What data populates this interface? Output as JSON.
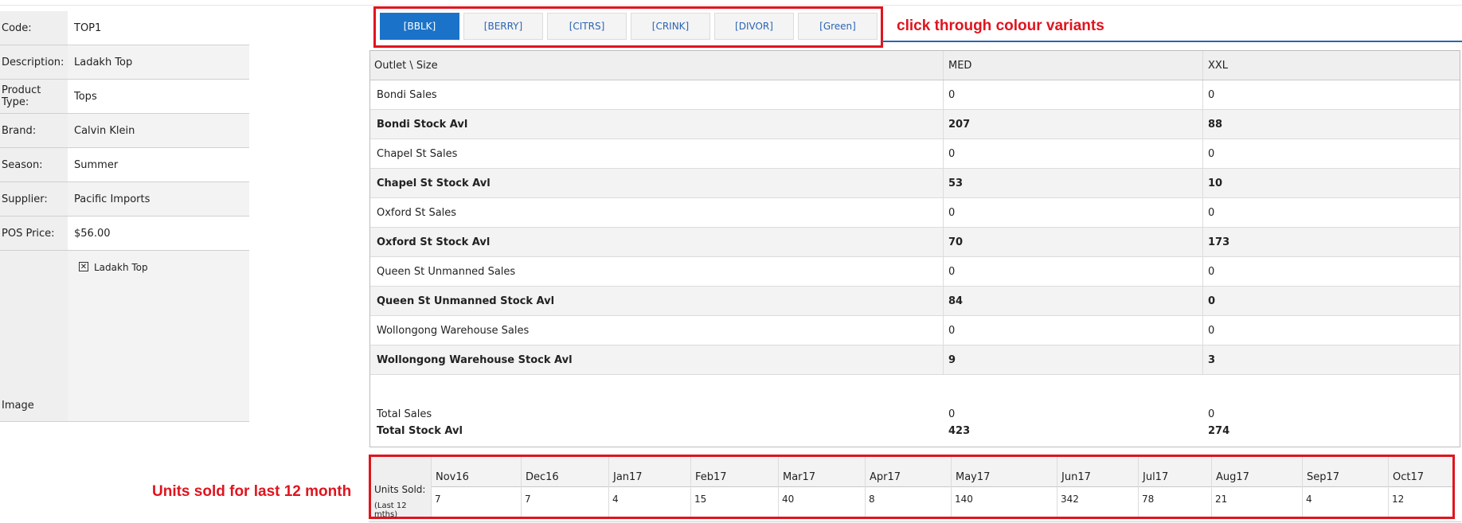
{
  "product": {
    "fields": [
      {
        "label": "Code:",
        "value": "TOP1"
      },
      {
        "label": "Description:",
        "value": "Ladakh Top"
      },
      {
        "label": "Product Type:",
        "value": "Tops"
      },
      {
        "label": "Brand:",
        "value": "Calvin Klein"
      },
      {
        "label": "Season:",
        "value": "Summer"
      },
      {
        "label": "Supplier:",
        "value": "Pacific Imports"
      },
      {
        "label": "POS Price:",
        "value": "$56.00"
      }
    ],
    "image_label": "Image",
    "image_alt": "Ladakh Top",
    "image_icon": "broken-image-icon"
  },
  "variants": {
    "tabs": [
      "[BBLK]",
      "[BERRY]",
      "[CITRS]",
      "[CRINK]",
      "[DIVOR]",
      "[Green]"
    ],
    "active_index": 0,
    "annotation": "click through colour variants"
  },
  "stock_table": {
    "headers": [
      "Outlet \\ Size",
      "MED",
      "XXL"
    ],
    "rows": [
      {
        "outlet": "Bondi Sales",
        "med": "0",
        "xxl": "0",
        "bold": false
      },
      {
        "outlet": "Bondi Stock Avl",
        "med": "207",
        "xxl": "88",
        "bold": true
      },
      {
        "outlet": "Chapel St Sales",
        "med": "0",
        "xxl": "0",
        "bold": false
      },
      {
        "outlet": "Chapel St Stock Avl",
        "med": "53",
        "xxl": "10",
        "bold": true
      },
      {
        "outlet": "Oxford St Sales",
        "med": "0",
        "xxl": "0",
        "bold": false
      },
      {
        "outlet": "Oxford St Stock Avl",
        "med": "70",
        "xxl": "173",
        "bold": true
      },
      {
        "outlet": "Queen St Unmanned Sales",
        "med": "0",
        "xxl": "0",
        "bold": false
      },
      {
        "outlet": "Queen St Unmanned Stock Avl",
        "med": "84",
        "xxl": "0",
        "bold": true
      },
      {
        "outlet": "Wollongong Warehouse Sales",
        "med": "0",
        "xxl": "0",
        "bold": false
      },
      {
        "outlet": "Wollongong Warehouse Stock Avl",
        "med": "9",
        "xxl": "3",
        "bold": true
      }
    ],
    "totals": [
      {
        "label": "Total Sales",
        "med": "0",
        "xxl": "0",
        "bold": false
      },
      {
        "label": "Total Stock Avl",
        "med": "423",
        "xxl": "274",
        "bold": true
      }
    ]
  },
  "units_sold": {
    "annotation": "Units sold for last 12 month",
    "label": "Units Sold:",
    "sublabel": "(Last 12 mths)",
    "months": [
      "Nov16",
      "Dec16",
      "Jan17",
      "Feb17",
      "Mar17",
      "Apr17",
      "May17",
      "Jun17",
      "Jul17",
      "Aug17",
      "Sep17",
      "Oct17"
    ],
    "values": [
      "7",
      "7",
      "4",
      "15",
      "40",
      "8",
      "140",
      "342",
      "78",
      "21",
      "4",
      "12"
    ]
  },
  "colors": {
    "highlight": "#e0141e",
    "active_tab": "#1a73c9",
    "tab_text": "#2a64b3"
  }
}
